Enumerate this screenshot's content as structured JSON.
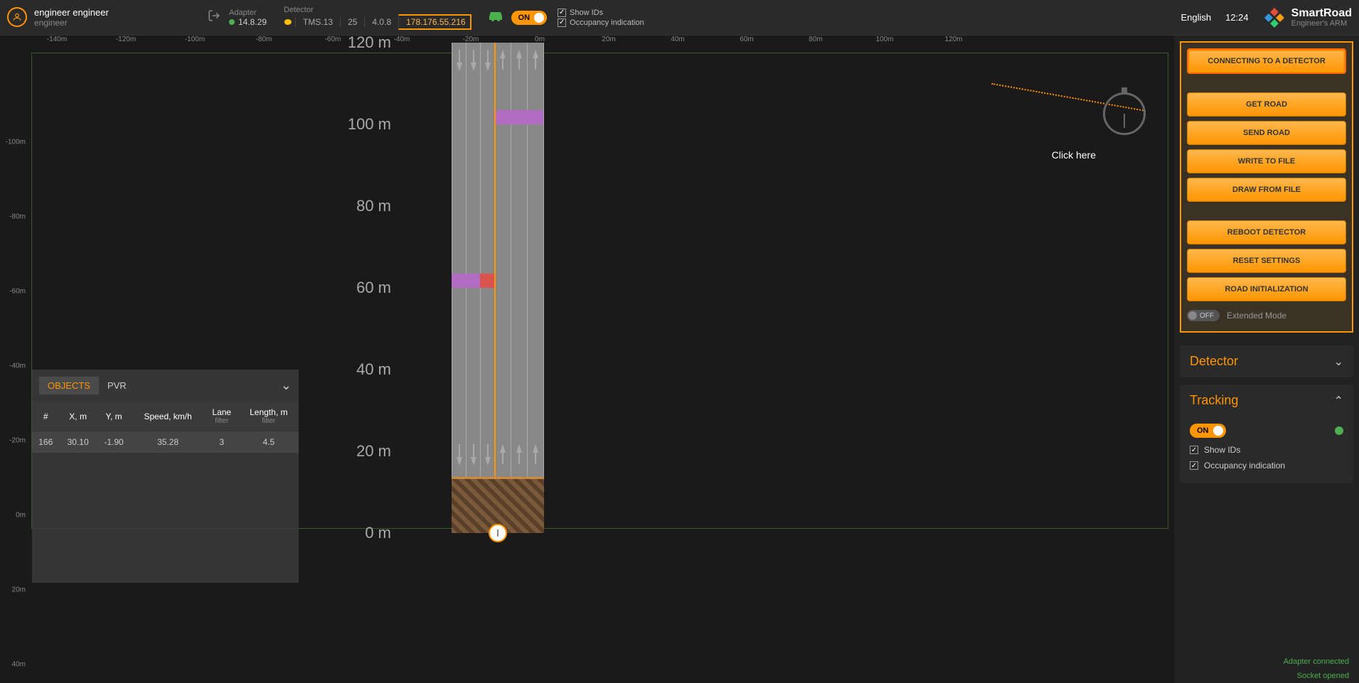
{
  "header": {
    "user_name": "engineer engineer",
    "user_role": "engineer",
    "adapter_label": "Adapter",
    "adapter_version": "14.8.29",
    "detector_label": "Detector",
    "detector_name": "TMS.13",
    "detector_v1": "25",
    "detector_v2": "4.0.8",
    "detector_ip": "178.176.55.216",
    "on_label": "ON",
    "cb_show_ids": "Show IDs",
    "cb_occupancy": "Occupancy indication",
    "language": "English",
    "time": "12:24",
    "app_name": "SmartRoad",
    "app_sub": "Engineer's ARM"
  },
  "ruler_top": [
    "-140m",
    "-120m",
    "-100m",
    "-80m",
    "-60m",
    "-40m",
    "-20m",
    "0m",
    "20m",
    "40m",
    "60m",
    "80m",
    "100m",
    "120m"
  ],
  "ruler_left": [
    "-100m",
    "-80m",
    "-60m",
    "-40m",
    "-20m",
    "0m",
    "20m",
    "40m"
  ],
  "y_labels": [
    "120 m",
    "100 m",
    "80 m",
    "60 m",
    "40 m",
    "20 m",
    "0 m"
  ],
  "click_here": "Click here",
  "objects": {
    "tab_objects": "OBJECTS",
    "tab_pvr": "PVR",
    "headers": {
      "num": "#",
      "x": "X, m",
      "y": "Y, m",
      "speed": "Speed, km/h",
      "lane": "Lane",
      "lane_f": "filter",
      "len": "Length, m",
      "len_f": "filter"
    },
    "rows": [
      {
        "num": "166",
        "x": "30.10",
        "y": "-1.90",
        "speed": "35.28",
        "lane": "3",
        "len": "4.5"
      }
    ]
  },
  "right": {
    "btn_connect": "CONNECTING TO A DETECTOR",
    "btn_get_road": "GET ROAD",
    "btn_send_road": "SEND ROAD",
    "btn_write_file": "WRITE TO FILE",
    "btn_draw_file": "DRAW FROM FILE",
    "btn_reboot": "REBOOT DETECTOR",
    "btn_reset": "RESET SETTINGS",
    "btn_road_init": "ROAD INITIALIZATION",
    "ext_mode": "Extended Mode",
    "off_label": "OFF",
    "detector_section": "Detector",
    "tracking_section": "Tracking",
    "tracking_on": "ON",
    "track_show_ids": "Show IDs",
    "track_occupancy": "Occupancy indication",
    "status_adapter": "Adapter connected",
    "status_socket": "Socket opened"
  }
}
